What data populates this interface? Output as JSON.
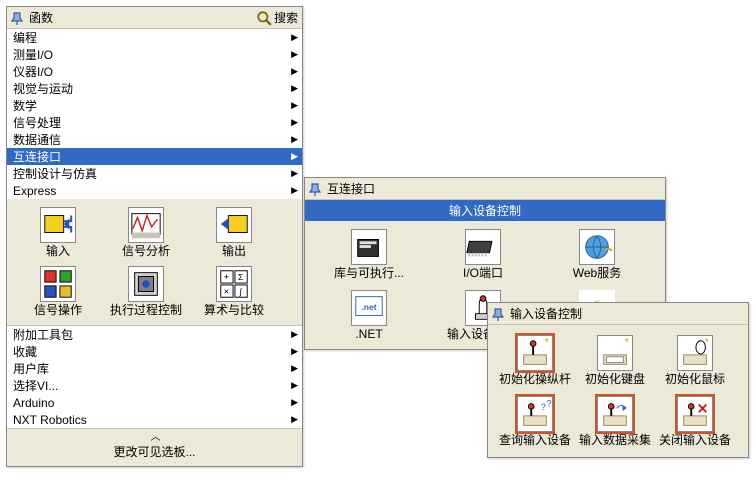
{
  "mainPanel": {
    "title": "函数",
    "searchLabel": "搜索",
    "menu": [
      "编程",
      "测量I/O",
      "仪器I/O",
      "视觉与运动",
      "数学",
      "信号处理",
      "数据通信",
      "互连接口",
      "控制设计与仿真",
      "Express"
    ],
    "expressItems": [
      {
        "label": "输入"
      },
      {
        "label": "信号分析"
      },
      {
        "label": "输出"
      },
      {
        "label": "信号操作"
      },
      {
        "label": "执行过程控制"
      },
      {
        "label": "算术与比较"
      }
    ],
    "menu2": [
      "附加工具包",
      "收藏",
      "用户库",
      "选择VI...",
      "Arduino",
      "NXT Robotics"
    ],
    "footerLabel": "更改可见选板..."
  },
  "subPanel": {
    "title": "互连接口",
    "bar": "输入设备控制",
    "items": [
      {
        "label": "库与可执行..."
      },
      {
        "label": "I/O端口"
      },
      {
        "label": "Web服务"
      },
      {
        "label": ".NET"
      },
      {
        "label": "输入设备控制"
      },
      {
        "label": ""
      }
    ]
  },
  "subPanel2": {
    "title": "输入设备控制",
    "items": [
      {
        "label": "初始化操纵杆",
        "hl": true
      },
      {
        "label": "初始化键盘",
        "hl": false
      },
      {
        "label": "初始化鼠标",
        "hl": false
      },
      {
        "label": "查询输入设备",
        "hl": true
      },
      {
        "label": "输入数据采集",
        "hl": true
      },
      {
        "label": "关闭输入设备",
        "hl": true
      }
    ]
  },
  "selectedMenuIndex": 7
}
